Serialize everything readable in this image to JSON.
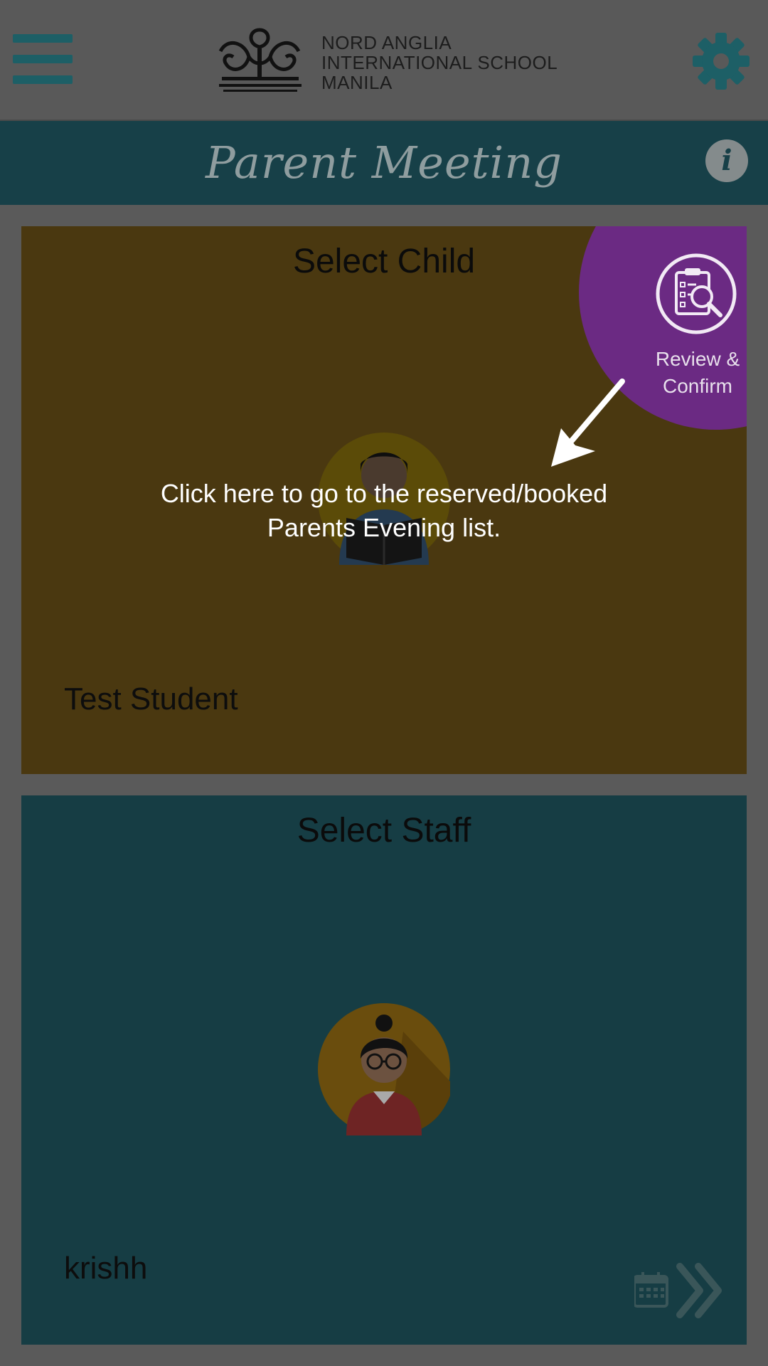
{
  "header": {
    "logo_lines": [
      "NORD ANGLIA",
      "INTERNATIONAL SCHOOL",
      "MANILA"
    ]
  },
  "titlebar": {
    "title": "Parent Meeting",
    "info_label": "i"
  },
  "child_card": {
    "title": "Select Child",
    "name": "Test Student"
  },
  "staff_card": {
    "title": "Select Staff",
    "name": "krishh"
  },
  "review": {
    "label_line1": "Review &",
    "label_line2": "Confirm"
  },
  "hint": {
    "line1": "Click here to go to the reserved/booked",
    "line2": "Parents Evening list."
  },
  "colors": {
    "accent_teal": "#1d5f66",
    "review_purple": "#6b2a83",
    "child_card": "#4a3810",
    "staff_card": "#163d44"
  },
  "icons": [
    "menu-icon",
    "school-crest-logo",
    "gear-icon",
    "info-icon",
    "student-avatar",
    "review-clipboard-icon",
    "arrow-icon",
    "teacher-avatar",
    "calendar-icon",
    "double-chevron-right-icon"
  ]
}
